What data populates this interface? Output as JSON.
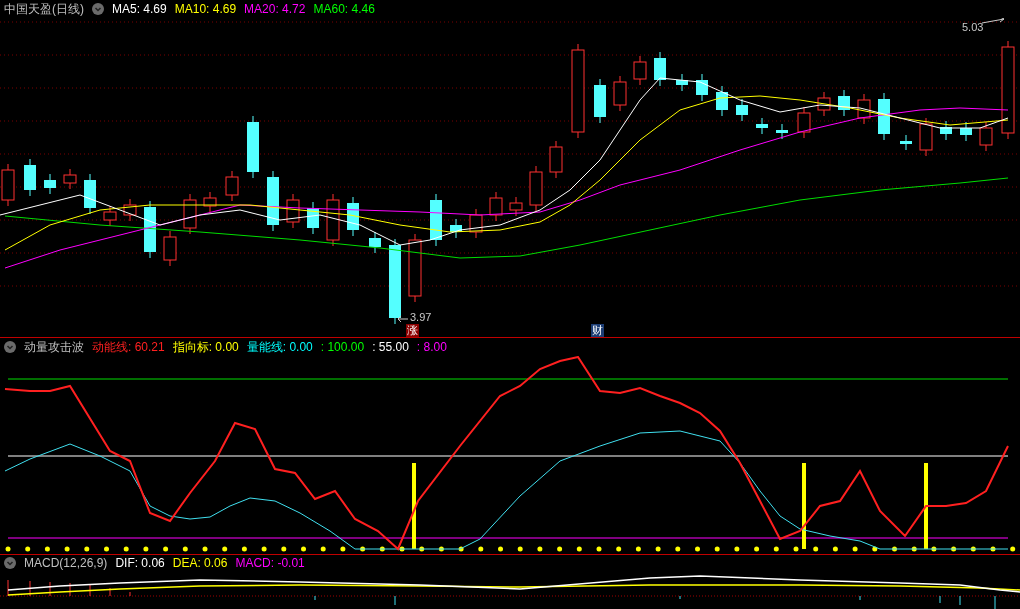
{
  "main_chart": {
    "title": "中国天盈(日线)",
    "indicators": [
      {
        "label": "MA5: 4.69",
        "color": "#ffffff"
      },
      {
        "label": "MA10: 4.69",
        "color": "#ffff00"
      },
      {
        "label": "MA20: 4.72",
        "color": "#ff00ff"
      },
      {
        "label": "MA60: 4.46",
        "color": "#00ff00"
      }
    ],
    "high_label": "5.03",
    "low_label": "3.97",
    "markers": [
      {
        "text": "涨",
        "color": "#8b0000"
      },
      {
        "text": "财",
        "color": "#1c3d74"
      }
    ]
  },
  "momentum_panel": {
    "title": "动量攻击波",
    "indicators": [
      {
        "label": "动能线: 60.21",
        "color": "#ff2020"
      },
      {
        "label": "指向标: 0.00",
        "color": "#ffff00"
      },
      {
        "label": "量能线: 0.00",
        "color": "#00ffff"
      },
      {
        "label": ": 100.00",
        "color": "#00ff00"
      },
      {
        "label": ": 55.00",
        "color": "#ffffff"
      },
      {
        "label": ": 8.00",
        "color": "#ff00ff"
      }
    ]
  },
  "macd_panel": {
    "title": "MACD(12,26,9)",
    "indicators": [
      {
        "label": "DIF: 0.06",
        "color": "#ffffff"
      },
      {
        "label": "DEA: 0.06",
        "color": "#ffff00"
      },
      {
        "label": "MACD: -0.01",
        "color": "#ff00ff"
      }
    ]
  }
}
